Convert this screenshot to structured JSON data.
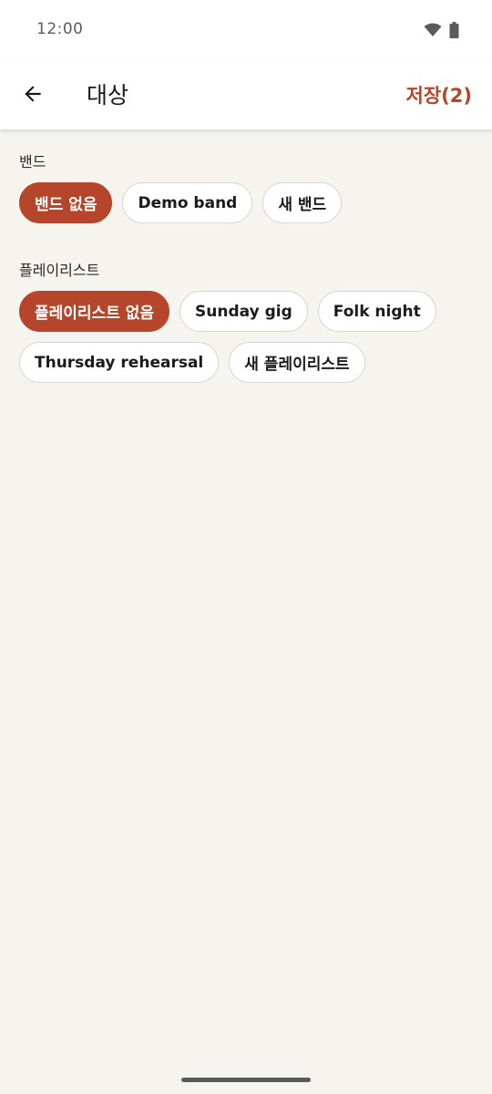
{
  "status_bar": {
    "time": "12:00",
    "icons": [
      "wifi-icon",
      "battery-icon"
    ]
  },
  "app_bar": {
    "back_icon": "arrow-left-icon",
    "title": "대상",
    "save_label": "저장(2)"
  },
  "colors": {
    "accent": "#b5462b",
    "background": "#f6f4ef",
    "surface": "#ffffff",
    "chip_border": "#d9d6cf"
  },
  "band_section": {
    "label": "밴드",
    "chips": [
      {
        "label": "밴드 없음",
        "selected": true
      },
      {
        "label": "Demo band",
        "selected": false
      },
      {
        "label": "새 밴드",
        "selected": false
      }
    ]
  },
  "playlist_section": {
    "label": "플레이리스트",
    "chips": [
      {
        "label": "플레이리스트 없음",
        "selected": true
      },
      {
        "label": "Sunday gig",
        "selected": false
      },
      {
        "label": "Folk night",
        "selected": false
      },
      {
        "label": "Thursday rehearsal",
        "selected": false
      },
      {
        "label": "새 플레이리스트",
        "selected": false
      }
    ]
  }
}
